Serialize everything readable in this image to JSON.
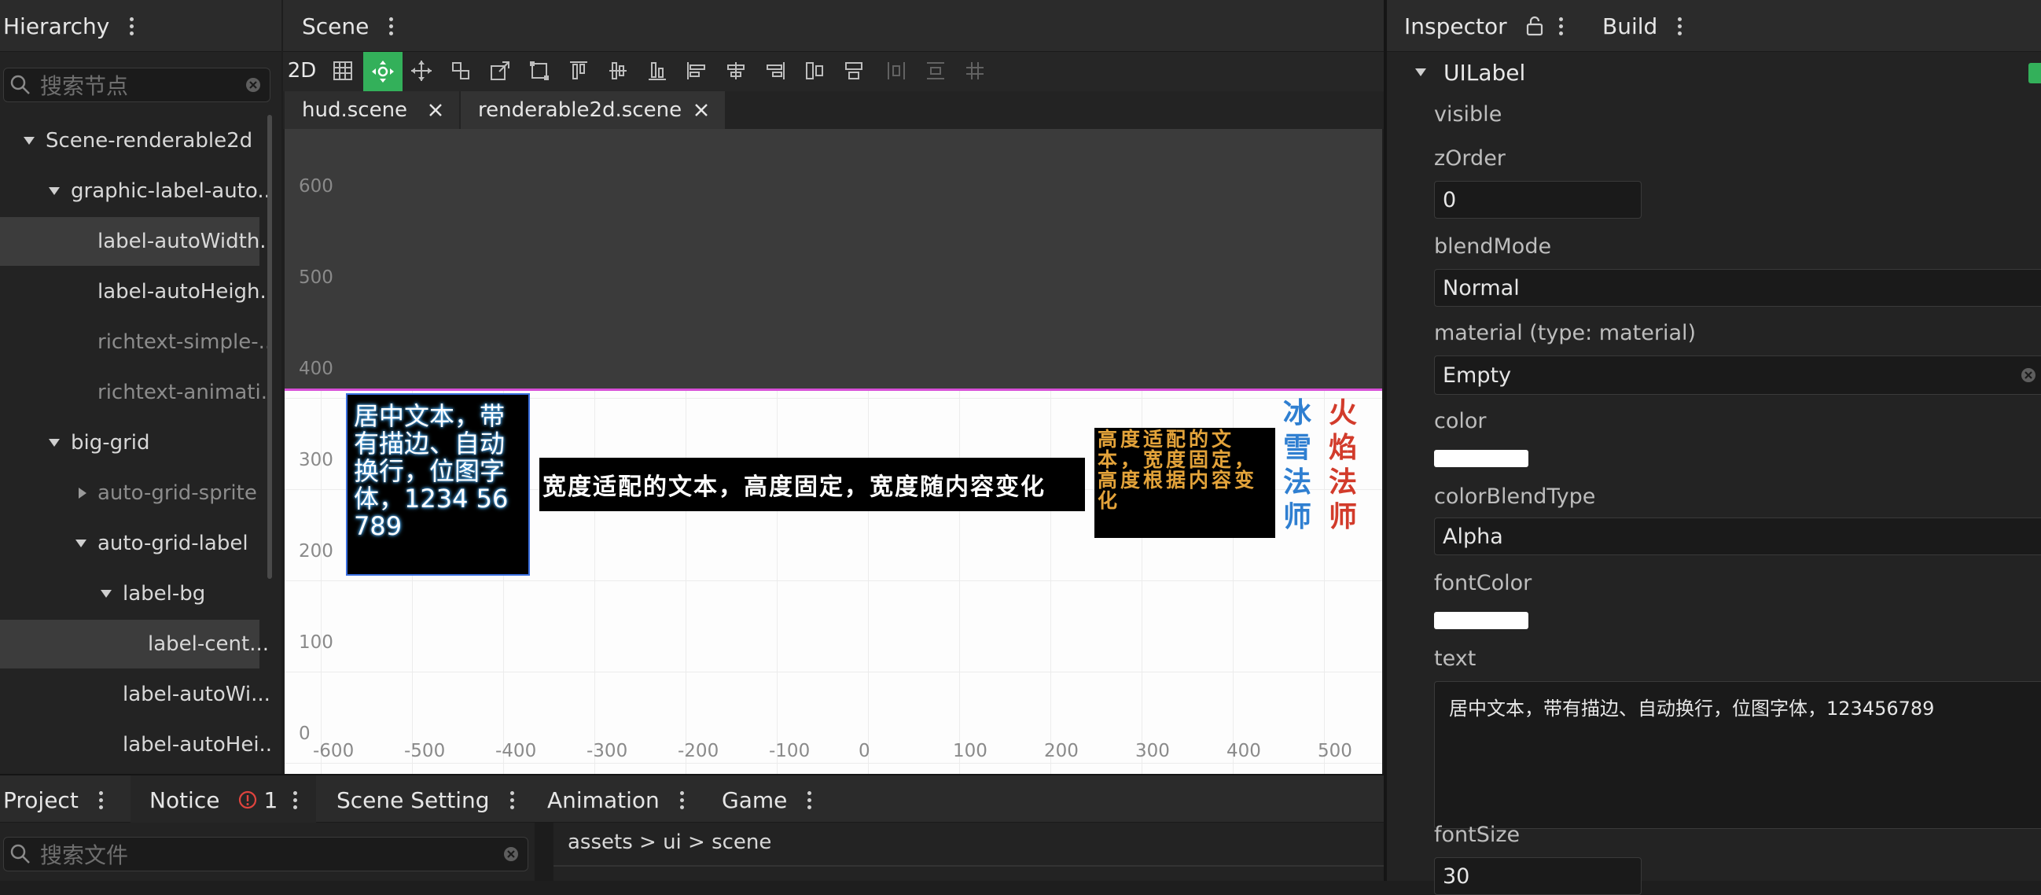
{
  "hierarchy": {
    "title": "Hierarchy",
    "search_placeholder": "搜索节点",
    "nodes": [
      {
        "label": "Scene-renderable2d"
      },
      {
        "label": "graphic-label-auto..."
      },
      {
        "label": "label-autoWidth..."
      },
      {
        "label": "label-autoHeigh..."
      },
      {
        "label": "richtext-simple-..."
      },
      {
        "label": "richtext-animati..."
      },
      {
        "label": "big-grid"
      },
      {
        "label": "auto-grid-sprite"
      },
      {
        "label": "auto-grid-label"
      },
      {
        "label": "label-bg"
      },
      {
        "label": "label-cent..."
      },
      {
        "label": "label-autoWi..."
      },
      {
        "label": "label-autoHei..."
      }
    ]
  },
  "scene": {
    "title": "Scene",
    "mode_2d": "2D",
    "tabs": [
      {
        "label": "hud.scene"
      },
      {
        "label": "renderable2d.scene"
      }
    ],
    "y_ticks": [
      "600",
      "500",
      "400",
      "300",
      "200",
      "100",
      "0"
    ],
    "x_ticks": [
      "-600",
      "-500",
      "-400",
      "-300",
      "-200",
      "-100",
      "0",
      "100",
      "200",
      "300",
      "400",
      "500"
    ],
    "labels": {
      "center_text": "居中文本，带有描边、自动换行，位图字体，1234 56789",
      "width_text": "宽度适配的文本，高度固定，宽度随内容变化",
      "height_text": "高度适配的文本，宽度固定，高度根据内容变化",
      "ice_mage": "冰雪法师",
      "fire_mage": "火焰法师"
    }
  },
  "inspector": {
    "title": "Inspector",
    "build_tab": "Build",
    "component": "UILabel",
    "props": {
      "visible": "visible",
      "zorder_label": "zOrder",
      "zorder_value": "0",
      "blend_label": "blendMode",
      "blend_value": "Normal",
      "material_label": "material (type: material)",
      "material_value": "Empty",
      "color_label": "color",
      "color_value": "#ffffff",
      "cbt_label": "colorBlendType",
      "cbt_value": "Alpha",
      "fontcolor_label": "fontColor",
      "fontcolor_value": "#ffffff",
      "text_label": "text",
      "text_value": "居中文本，带有描边、自动换行，位图字体，123456789",
      "fontsize_label": "fontSize",
      "fontsize_value": "30"
    }
  },
  "bottom": {
    "tabs": [
      {
        "label": "Project"
      },
      {
        "label": "Notice"
      },
      {
        "label": "Scene Setting"
      },
      {
        "label": "Animation"
      },
      {
        "label": "Game"
      }
    ],
    "notice_count": "1",
    "search_placeholder": "搜索文件",
    "breadcrumb": "assets > ui > scene"
  },
  "colors": {
    "accent_green": "#33b05a",
    "selection_line": "#d84fd8",
    "ice": "#2f7fd1",
    "fire": "#d23b2b",
    "gold": "#e3a33a"
  }
}
